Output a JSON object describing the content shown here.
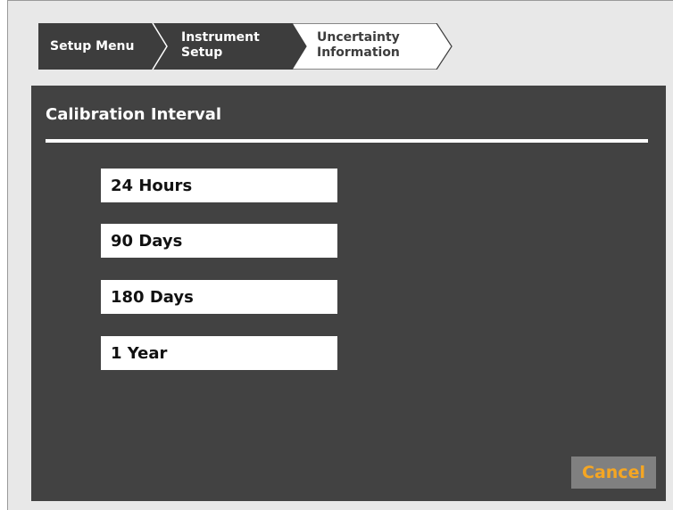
{
  "breadcrumb": {
    "items": [
      {
        "label": "Setup Menu"
      },
      {
        "label_line1": "Instrument",
        "label_line2": "Setup"
      },
      {
        "label_line1": "Uncertainty",
        "label_line2": "Information"
      }
    ]
  },
  "panel": {
    "title": "Calibration Interval",
    "options": [
      {
        "label": "24 Hours"
      },
      {
        "label": "90 Days"
      },
      {
        "label": "180 Days"
      },
      {
        "label": "1 Year"
      }
    ],
    "cancel_label": "Cancel"
  },
  "colors": {
    "panel_bg": "#424242",
    "crumb_active_bg": "#3d3d3d",
    "cancel_text": "#f5a623",
    "cancel_bg": "#808080"
  }
}
